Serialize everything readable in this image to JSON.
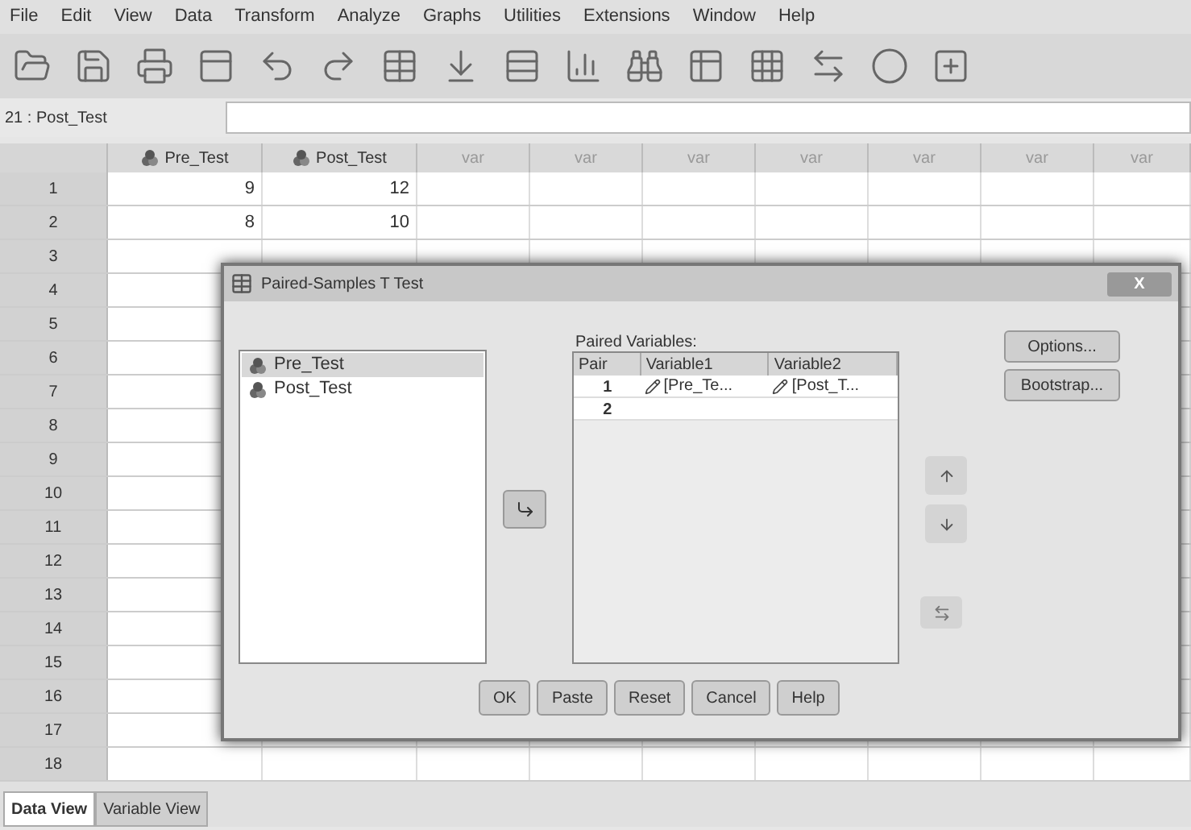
{
  "menu": [
    "File",
    "Edit",
    "View",
    "Data",
    "Transform",
    "Analyze",
    "Graphs",
    "Utilities",
    "Extensions",
    "Window",
    "Help"
  ],
  "cell_ref": "21 : Post_Test",
  "columns": [
    {
      "label": "Pre_Test",
      "kind": "variable"
    },
    {
      "label": "Post_Test",
      "kind": "variable"
    },
    {
      "label": "var",
      "kind": "empty"
    },
    {
      "label": "var",
      "kind": "empty"
    },
    {
      "label": "var",
      "kind": "empty"
    },
    {
      "label": "var",
      "kind": "empty"
    },
    {
      "label": "var",
      "kind": "empty"
    },
    {
      "label": "var",
      "kind": "empty"
    },
    {
      "label": "var",
      "kind": "empty"
    }
  ],
  "rows": [
    {
      "label": "1",
      "cells": [
        "9",
        "12"
      ]
    },
    {
      "label": "2",
      "cells": [
        "8",
        "10"
      ]
    },
    {
      "label": "3"
    },
    {
      "label": "4"
    },
    {
      "label": "5"
    },
    {
      "label": "6"
    },
    {
      "label": "7"
    },
    {
      "label": "8"
    },
    {
      "label": "9"
    },
    {
      "label": "10"
    },
    {
      "label": "11"
    },
    {
      "label": "12"
    },
    {
      "label": "13"
    },
    {
      "label": "14"
    },
    {
      "label": "15"
    },
    {
      "label": "16"
    },
    {
      "label": "17"
    },
    {
      "label": "18"
    }
  ],
  "tabs": [
    {
      "label": "Data View",
      "selected": true
    },
    {
      "label": "Variable View",
      "selected": false
    }
  ],
  "dialog": {
    "title": "Paired-Samples T Test",
    "close": "X",
    "variables": [
      {
        "label": "Pre_Test",
        "selected": true
      },
      {
        "label": "Post_Test",
        "selected": false
      }
    ],
    "paired_label": "Paired Variables:",
    "paired_columns": [
      "Pair",
      "Variable1",
      "Variable2"
    ],
    "paired_rows": [
      {
        "pair": "1",
        "variable1": "[Pre_Te...",
        "variable2": "[Post_T..."
      },
      {
        "pair": "2"
      }
    ],
    "side_buttons": [
      "Options...",
      "Bootstrap..."
    ],
    "buttons": [
      "OK",
      "Paste",
      "Reset",
      "Cancel",
      "Help"
    ]
  }
}
